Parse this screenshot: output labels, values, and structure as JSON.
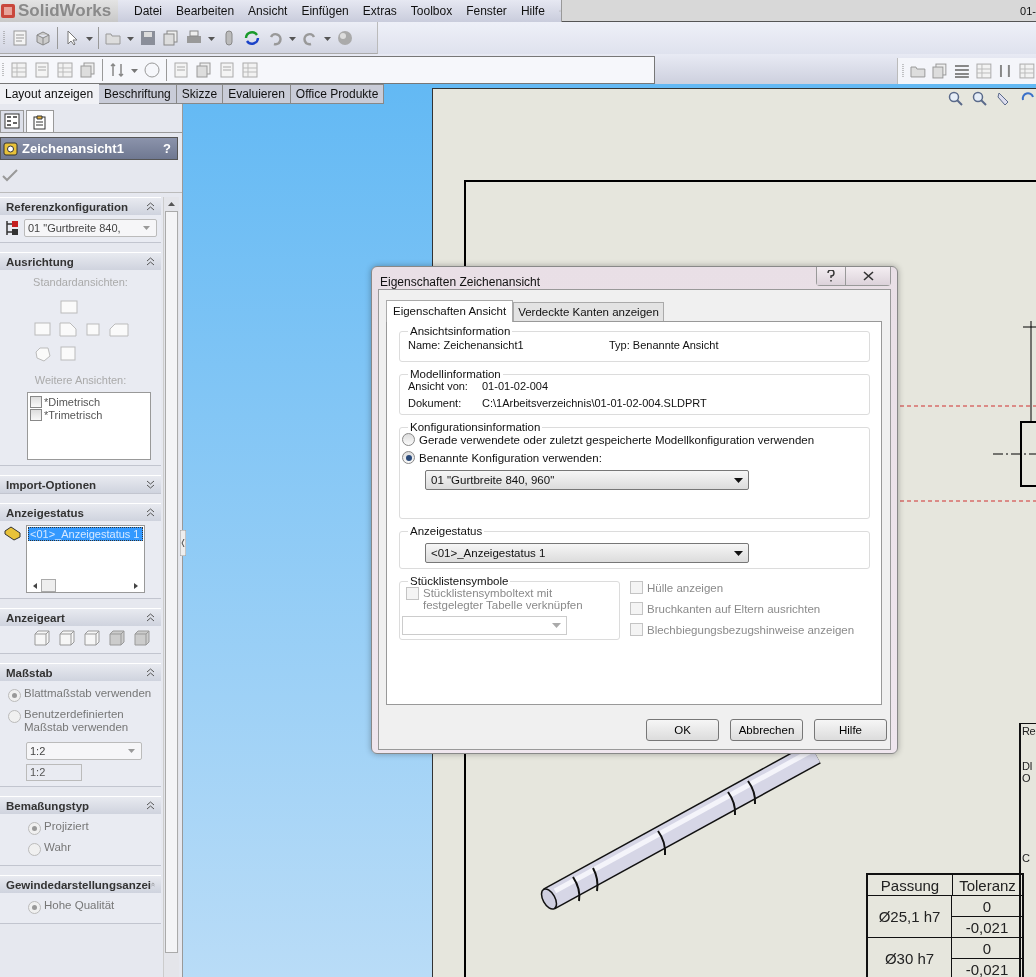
{
  "app": {
    "logo": "SolidWorks",
    "doc_title": "01-"
  },
  "menu": [
    {
      "label": "Datei"
    },
    {
      "label": "Bearbeiten"
    },
    {
      "label": "Ansicht"
    },
    {
      "label": "Einfügen"
    },
    {
      "label": "Extras"
    },
    {
      "label": "Toolbox"
    },
    {
      "label": "Fenster"
    },
    {
      "label": "Hilfe"
    }
  ],
  "command_tabs": [
    {
      "label": "Layout anzeigen",
      "selected": true
    },
    {
      "label": "Beschriftung",
      "selected": false
    },
    {
      "label": "Skizze",
      "selected": false
    },
    {
      "label": "Evaluieren",
      "selected": false
    },
    {
      "label": "Office Produkte",
      "selected": false
    }
  ],
  "panel": {
    "tabs": [
      {
        "kind": "tree",
        "selected": false
      },
      {
        "kind": "properties",
        "selected": true
      }
    ],
    "title": "Zeichenansicht1",
    "help": "?",
    "sections": [
      {
        "kind": "config",
        "title": "Referenzkonfiguration",
        "expanded": true,
        "value": "01 \"Gurtbreite 840,"
      },
      {
        "kind": "orientation",
        "title": "Ausrichtung",
        "expanded": true,
        "label": "Standardansichten:",
        "label2": "Weitere Ansichten:",
        "items": [
          {
            "label": "*Dimetrisch",
            "checked": false
          },
          {
            "label": "*Trimetrisch",
            "checked": false
          }
        ]
      },
      {
        "title": "Import-Optionen",
        "expanded": false
      },
      {
        "kind": "status",
        "title": "Anzeigestatus",
        "expanded": true,
        "items": [
          {
            "label": "<01>_Anzeigestatus 1",
            "selected": true
          }
        ]
      },
      {
        "kind": "display",
        "title": "Anzeigeart",
        "expanded": true
      },
      {
        "kind": "scale",
        "title": "Maßstab",
        "expanded": true,
        "options": [
          {
            "label": "Blattmaßstab verwenden",
            "selected": true
          },
          {
            "label": "Benutzerdefinierten Maßstab verwenden",
            "selected": false
          }
        ],
        "select": "1:2",
        "field": "1:2"
      },
      {
        "kind": "radios",
        "title": "Bemaßungstyp",
        "expanded": true,
        "options": [
          {
            "label": "Projiziert",
            "selected": true
          },
          {
            "label": "Wahr",
            "selected": false
          }
        ]
      },
      {
        "kind": "radios",
        "title": "Gewindedarstellungsanzei",
        "expanded": true,
        "options": [
          {
            "label": "Hohe Qualität",
            "selected": true
          }
        ]
      }
    ]
  },
  "dialog": {
    "title": "Eigenschaften Zeichenansicht",
    "tabs": [
      {
        "label": "Eigenschaften Ansicht",
        "selected": true
      },
      {
        "label": "Verdeckte Kanten anzeigen",
        "selected": false
      }
    ],
    "view_info": {
      "title": "Ansichtsinformation",
      "name": "Name: Zeichenansicht1",
      "type": "Typ: Benannte Ansicht"
    },
    "model_info": {
      "title": "Modellinformation",
      "rows": [
        {
          "label": "Ansicht von:",
          "value": "01-01-02-004"
        },
        {
          "label": "Dokument:",
          "value": "C:\\1Arbeitsverzeichnis\\01-01-02-004.SLDPRT"
        }
      ]
    },
    "config_info": {
      "title": "Konfigurationsinformation",
      "options": [
        {
          "label": "Gerade verwendete oder zuletzt gespeicherte Modellkonfiguration verwenden",
          "selected": false
        },
        {
          "label": "Benannte Konfiguration verwenden:",
          "selected": true
        }
      ],
      "select": "01 \"Gurtbreite 840, 960\""
    },
    "display_status": {
      "title": "Anzeigestatus",
      "select": "<01>_Anzeigestatus 1"
    },
    "bom": {
      "title": "Stücklistensymbole",
      "label": "Stücklistensymboltext mit festgelegter Tabelle verknüpfen",
      "checked": false,
      "disabled": true
    },
    "options": [
      {
        "label": "Hülle anzeigen",
        "checked": false,
        "disabled": true
      },
      {
        "label": "Bruchkanten auf Eltern ausrichten",
        "checked": false,
        "disabled": true
      },
      {
        "label": "Blechbiegungsbezugshinweise anzeigen",
        "checked": false,
        "disabled": true
      }
    ],
    "buttons": [
      {
        "label": "OK"
      },
      {
        "label": "Abbrechen"
      },
      {
        "label": "Hilfe"
      }
    ]
  },
  "fit_table": {
    "columns": [
      "Passung",
      "Toleranz"
    ],
    "rows": [
      {
        "fit": "Ø25,1 h7",
        "upper": "0",
        "lower": "-0,021"
      },
      {
        "fit": "Ø30 h7",
        "upper": "0",
        "lower": "-0,021"
      }
    ]
  },
  "title_block": [
    "Re",
    "DI",
    "O",
    "C"
  ]
}
